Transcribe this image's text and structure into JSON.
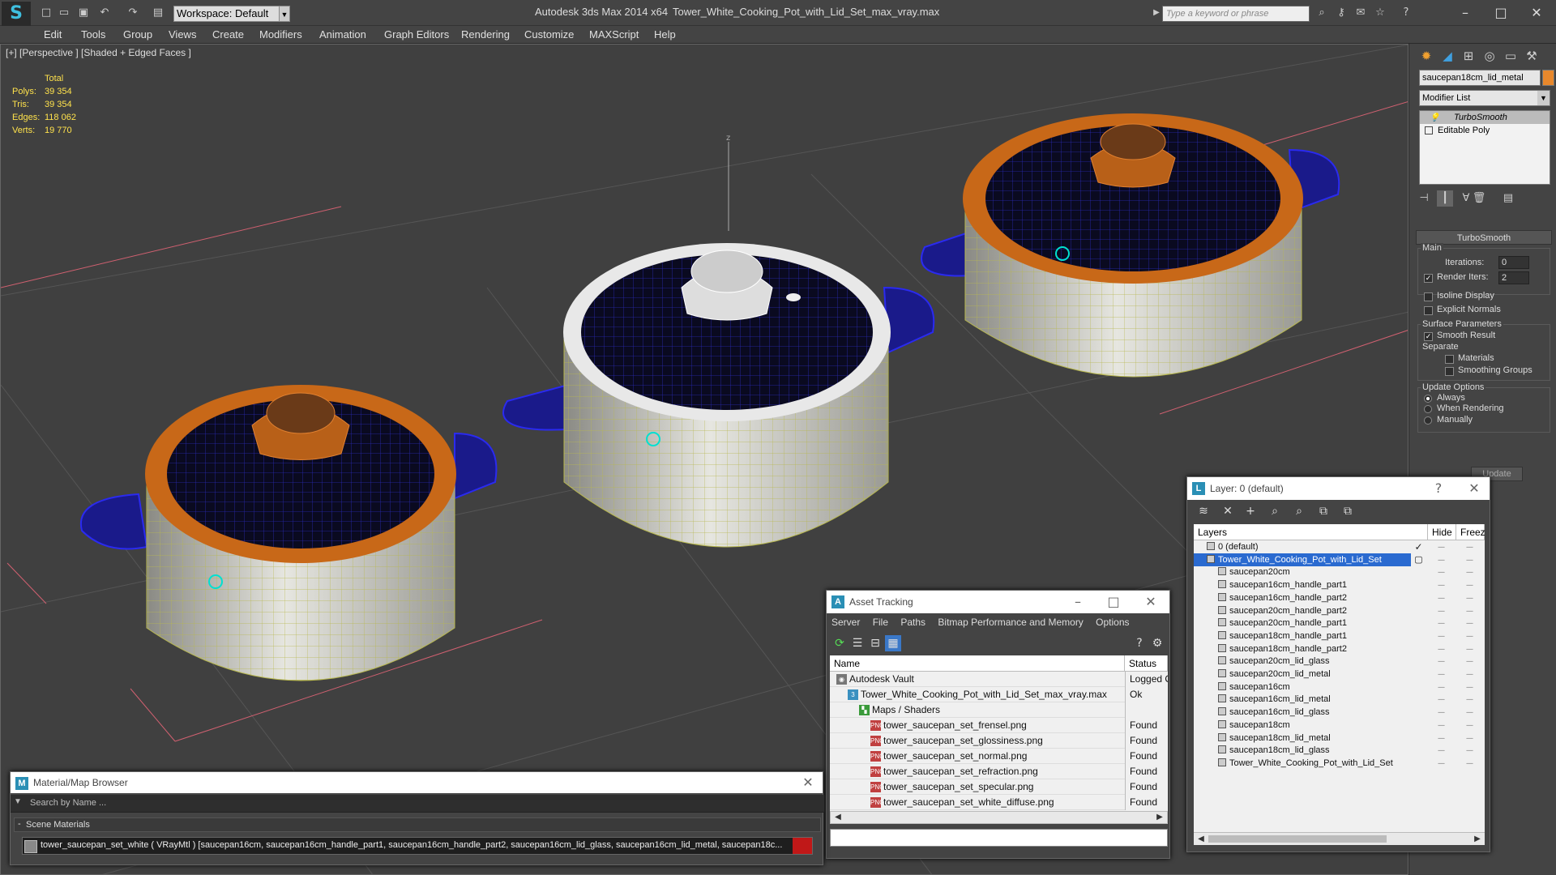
{
  "app": {
    "logo_glyph": "S",
    "workspace": "Workspace: Default",
    "title": "Autodesk 3ds Max  2014 x64",
    "file": "Tower_White_Cooking_Pot_with_Lid_Set_max_vray.max",
    "search_placeholder": "Type a keyword or phrase"
  },
  "menu": [
    "Edit",
    "Tools",
    "Group",
    "Views",
    "Create",
    "Modifiers",
    "Animation",
    "Graph Editors",
    "Rendering",
    "Customize",
    "MAXScript",
    "Help"
  ],
  "viewport": {
    "label": "[+] [Perspective ] [Shaded + Edged Faces ]",
    "stats": {
      "header": "Total",
      "polys_label": "Polys:",
      "polys": "39 354",
      "tris_label": "Tris:",
      "tris": "39 354",
      "edges_label": "Edges:",
      "edges": "118 062",
      "verts_label": "Verts:",
      "verts": "19 770"
    },
    "axis_label": "z"
  },
  "command_panel": {
    "object_name": "saucepan18cm_lid_metal",
    "object_color": "#e8882c",
    "modifier_list": "Modifier List",
    "stack": [
      "TurboSmooth",
      "Editable Poly"
    ],
    "rollout_title": "TurboSmooth",
    "main_label": "Main",
    "iterations_label": "Iterations:",
    "iterations": "0",
    "render_iters_label": "Render Iters:",
    "render_iters": "2",
    "render_iters_checked": true,
    "isoline_label": "Isoline Display",
    "explicit_normals_label": "Explicit Normals",
    "surface_params_label": "Surface Parameters",
    "smooth_result_label": "Smooth Result",
    "separate_label": "Separate",
    "materials_label": "Materials",
    "smoothing_groups_label": "Smoothing Groups",
    "update_options_label": "Update Options",
    "always_label": "Always",
    "when_rendering_label": "When Rendering",
    "manually_label": "Manually",
    "update_button": "Update"
  },
  "asset_tracking": {
    "title": "Asset Tracking",
    "menu": [
      "Server",
      "File",
      "Paths",
      "Bitmap Performance and Memory",
      "Options"
    ],
    "col_name": "Name",
    "col_status": "Status",
    "rows": [
      {
        "name": "Autodesk Vault",
        "status": "Logged O",
        "indent": 0,
        "icon": "vault"
      },
      {
        "name": "Tower_White_Cooking_Pot_with_Lid_Set_max_vray.max",
        "status": "Ok",
        "indent": 1,
        "icon": "max"
      },
      {
        "name": "Maps / Shaders",
        "status": "",
        "indent": 2,
        "icon": "maps"
      },
      {
        "name": "tower_saucepan_set_frensel.png",
        "status": "Found",
        "indent": 3,
        "icon": "png"
      },
      {
        "name": "tower_saucepan_set_glossiness.png",
        "status": "Found",
        "indent": 3,
        "icon": "png"
      },
      {
        "name": "tower_saucepan_set_normal.png",
        "status": "Found",
        "indent": 3,
        "icon": "png"
      },
      {
        "name": "tower_saucepan_set_refraction.png",
        "status": "Found",
        "indent": 3,
        "icon": "png"
      },
      {
        "name": "tower_saucepan_set_specular.png",
        "status": "Found",
        "indent": 3,
        "icon": "png"
      },
      {
        "name": "tower_saucepan_set_white_diffuse.png",
        "status": "Found",
        "indent": 3,
        "icon": "png"
      }
    ]
  },
  "layers": {
    "title": "Layer: 0 (default)",
    "col_layers": "Layers",
    "col_hide": "Hide",
    "col_freeze": "Freeze",
    "rows": [
      {
        "name": "0 (default)",
        "indent": 0,
        "selected": false,
        "active": true
      },
      {
        "name": "Tower_White_Cooking_Pot_with_Lid_Set",
        "indent": 0,
        "selected": true,
        "active": false
      },
      {
        "name": "saucepan20cm",
        "indent": 1
      },
      {
        "name": "saucepan16cm_handle_part1",
        "indent": 1
      },
      {
        "name": "saucepan16cm_handle_part2",
        "indent": 1
      },
      {
        "name": "saucepan20cm_handle_part2",
        "indent": 1
      },
      {
        "name": "saucepan20cm_handle_part1",
        "indent": 1
      },
      {
        "name": "saucepan18cm_handle_part1",
        "indent": 1
      },
      {
        "name": "saucepan18cm_handle_part2",
        "indent": 1
      },
      {
        "name": "saucepan20cm_lid_glass",
        "indent": 1
      },
      {
        "name": "saucepan20cm_lid_metal",
        "indent": 1
      },
      {
        "name": "saucepan16cm",
        "indent": 1
      },
      {
        "name": "saucepan16cm_lid_metal",
        "indent": 1
      },
      {
        "name": "saucepan16cm_lid_glass",
        "indent": 1
      },
      {
        "name": "saucepan18cm",
        "indent": 1
      },
      {
        "name": "saucepan18cm_lid_metal",
        "indent": 1
      },
      {
        "name": "saucepan18cm_lid_glass",
        "indent": 1
      },
      {
        "name": "Tower_White_Cooking_Pot_with_Lid_Set",
        "indent": 1
      }
    ]
  },
  "material_browser": {
    "title": "Material/Map Browser",
    "search_placeholder": "Search by Name ...",
    "section": "Scene Materials",
    "material": "tower_saucepan_set_white  ( VRayMtl ) [saucepan16cm, saucepan16cm_handle_part1, saucepan16cm_handle_part2, saucepan16cm_lid_glass, saucepan16cm_lid_metal, saucepan18c..."
  }
}
